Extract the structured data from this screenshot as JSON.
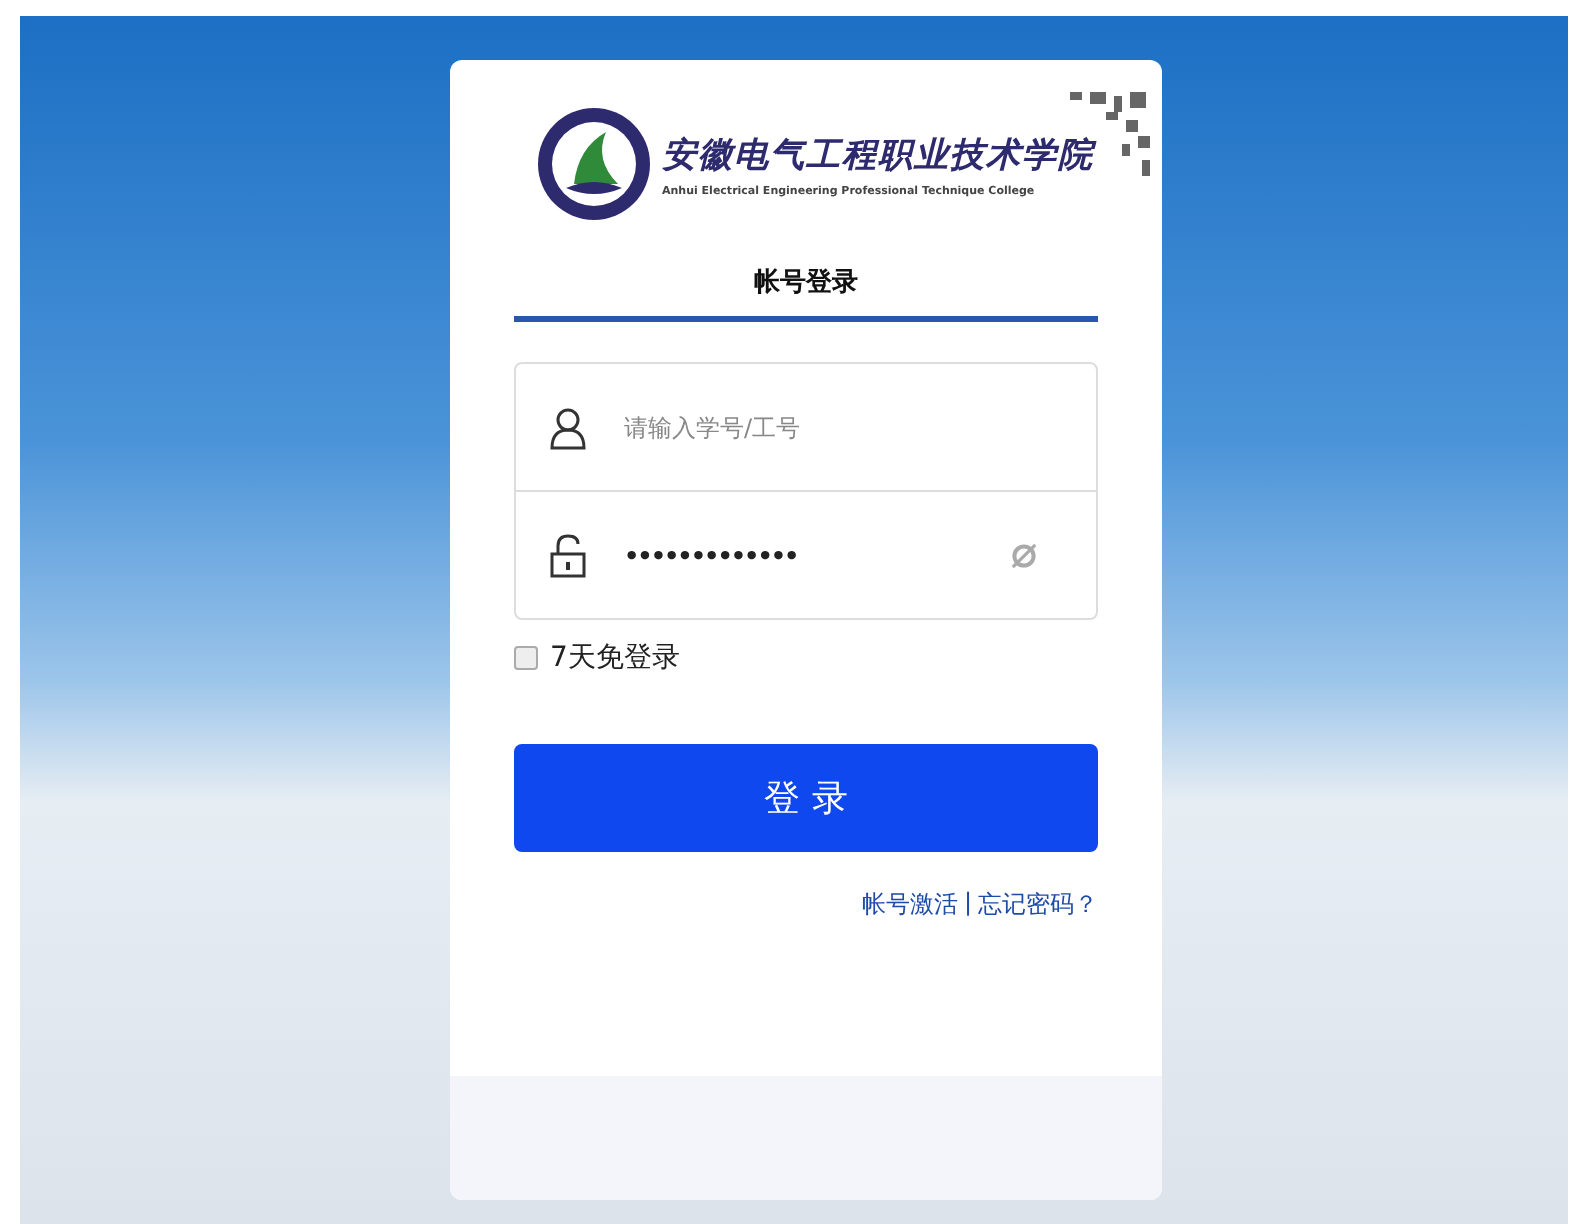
{
  "logo": {
    "name_cn": "安徽电气工程职业技术学院",
    "name_en": "Anhui Electrical Engineering Professional Technique College"
  },
  "tabs": [
    {
      "label": "帐号登录",
      "selected": true
    }
  ],
  "username": {
    "placeholder": "请输入学号/工号"
  },
  "password": {
    "value": "•••••••••••••"
  },
  "remember": {
    "label": "7天免登录",
    "checked": false
  },
  "login_button": "登 录",
  "links": {
    "activate": "帐号激活",
    "separator": "|",
    "forgot": "忘记密码？"
  }
}
